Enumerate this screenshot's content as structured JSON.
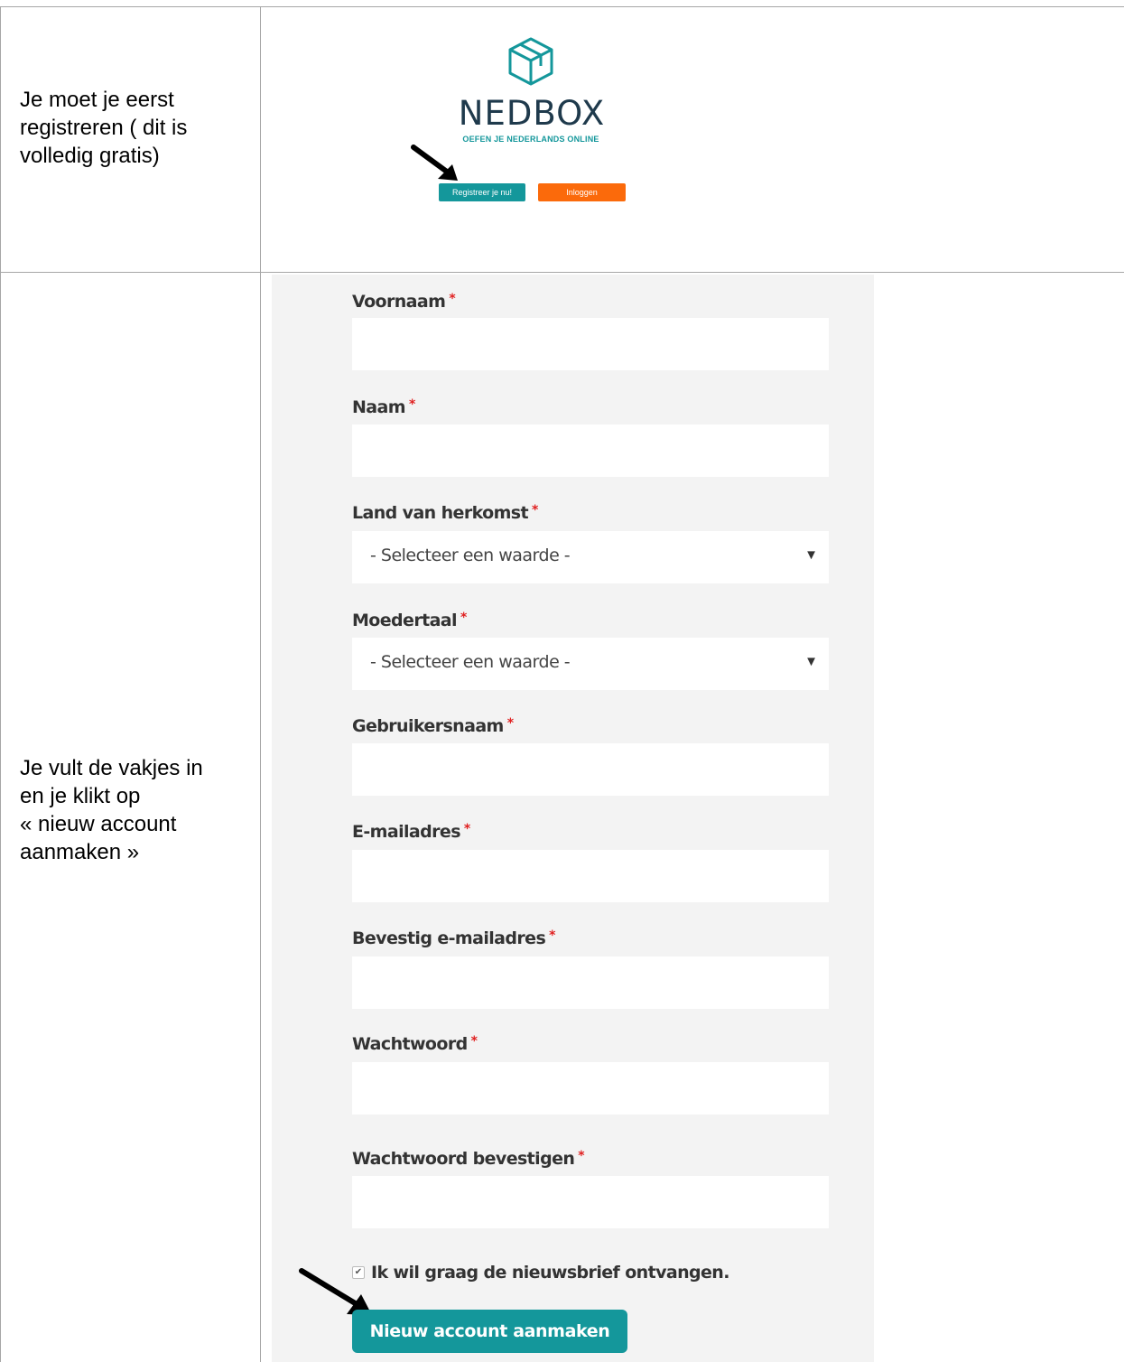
{
  "row1": {
    "instruction": [
      "Je moet je eerst",
      "registreren ( dit is",
      "volledig gratis)"
    ],
    "brand": {
      "name": "NEDBOX",
      "tagline": "OEFEN JE NEDERLANDS ONLINE",
      "register_button": "Registreer je nu!",
      "login_button": "Inloggen",
      "logo_icon": "box-icon"
    }
  },
  "row2": {
    "instruction": [
      "Je vult de vakjes in",
      "en je klikt op",
      "«  nieuw account",
      "aanmaken »"
    ],
    "form": {
      "required_mark": "*",
      "fields": {
        "voornaam": "Voornaam",
        "naam": "Naam",
        "land": "Land van herkomst",
        "moedertaal": "Moedertaal",
        "gebruikersnaam": "Gebruikersnaam",
        "email": "E-mailadres",
        "email_confirm": "Bevestig e-mailadres",
        "wachtwoord": "Wachtwoord",
        "wachtwoord_confirm": "Wachtwoord bevestigen"
      },
      "select_placeholder": "- Selecteer een waarde -",
      "newsletter_label": "Ik wil graag de nieuwsbrief ontvangen.",
      "newsletter_checked": true,
      "submit_label": "Nieuw account aanmaken"
    }
  },
  "colors": {
    "teal": "#14979b",
    "orange": "#fb6a0b",
    "navy": "#1f3a4c",
    "required": "#e02020",
    "panel": "#f3f3f3"
  }
}
